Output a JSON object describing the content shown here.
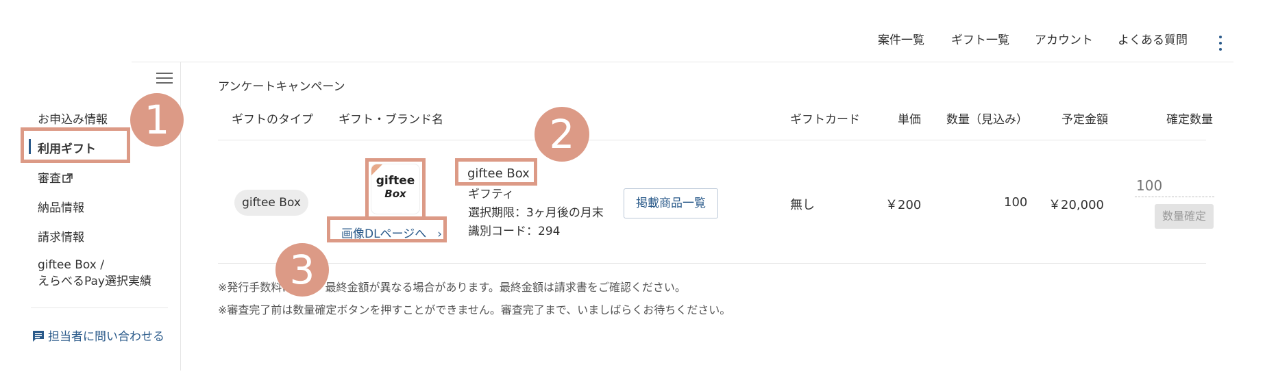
{
  "topnav": {
    "items": [
      "案件一覧",
      "ギフト一覧",
      "アカウント",
      "よくある質問"
    ]
  },
  "sidebar": {
    "items": [
      {
        "label": "お申込み情報"
      },
      {
        "label": "利用ギフト"
      },
      {
        "label": "審査"
      },
      {
        "label": "納品情報"
      },
      {
        "label": "請求情報"
      },
      {
        "label_line1": "giftee Box /",
        "label_line2": "えらべるPay選択実績"
      }
    ],
    "contact_label": "担当者に問い合わせる"
  },
  "main": {
    "title": "アンケートキャンペーン",
    "headers": [
      "ギフトのタイプ",
      "ギフト・ブランド名",
      "ギフトカード",
      "単価",
      "数量（見込み）",
      "予定金額",
      "確定数量"
    ],
    "row": {
      "type_chip": "giftee Box",
      "thumb_line1": "giftee",
      "thumb_line2": "Box",
      "dl_link": "画像DLページへ",
      "brand_name": "giftee Box",
      "brand_sub": "ギフティ",
      "period": "選択期限：3ヶ月後の月末",
      "code": "識別コード：294",
      "list_button": "掲載商品一覧",
      "gift_card": "無し",
      "unit_price": "￥200",
      "quantity": "100",
      "planned_amount": "￥20,000",
      "confirm_placeholder": "100",
      "confirm_button": "数量確定"
    },
    "notes": [
      "※発行手数料により、最終金額が異なる場合があります。最終金額は請求書をご確認ください。",
      "※審査完了前は数量確定ボタンを押すことができません。審査完了まで、いましばらくお待ちください。"
    ]
  },
  "annotations": [
    "1",
    "2",
    "3"
  ],
  "colors": {
    "accent": "#2a5a8a",
    "annotation": "#dc9a86"
  }
}
